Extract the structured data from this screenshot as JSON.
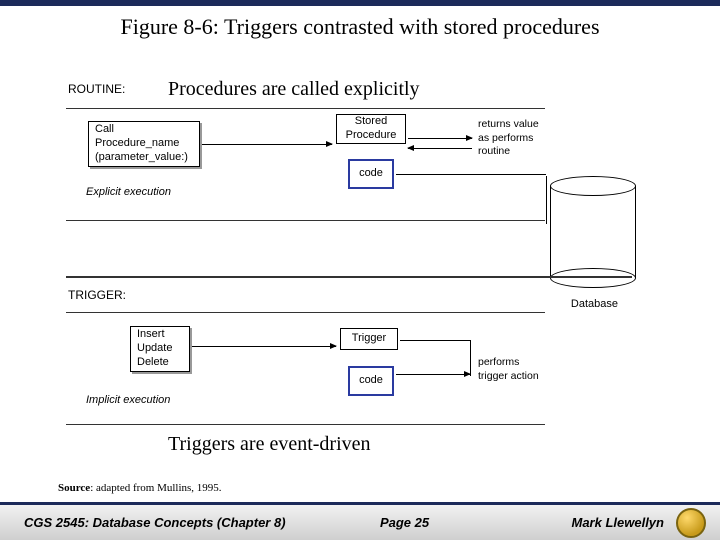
{
  "title": "Figure 8-6:  Triggers contrasted with stored procedures",
  "captions": {
    "procedures": "Procedures are called explicitly",
    "triggers": "Triggers are event-driven"
  },
  "labels": {
    "routine": "ROUTINE:",
    "trigger": "TRIGGER:",
    "call_box": "Call\nProcedure_name\n(parameter_value:)",
    "stored_procedure": "Stored\nProcedure",
    "code": "code",
    "explicit": "Explicit execution",
    "iud": "Insert\nUpdate\nDelete",
    "trigger_box": "Trigger",
    "implicit": "Implicit execution",
    "database": "Database",
    "returns_note": "returns value\nas performs\nroutine",
    "performs_note": "performs\ntrigger action"
  },
  "source": {
    "prefix": "Source",
    "text": ": adapted from Mullins, 1995."
  },
  "footer": {
    "course": "CGS 2545: Database Concepts  (Chapter 8)",
    "page": "Page 25",
    "author": "Mark Llewellyn"
  }
}
